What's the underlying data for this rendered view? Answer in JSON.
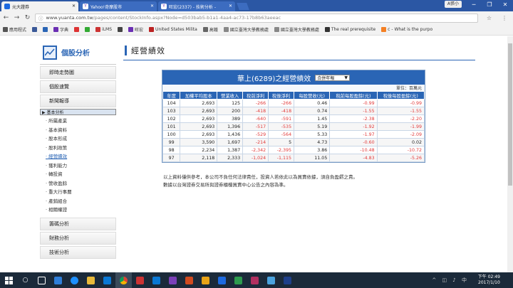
{
  "browser": {
    "tabs": [
      {
        "label": "元大證券",
        "color": "#1d6ae0"
      },
      {
        "label": "Yahoo!奇摩股市",
        "color": "#6b2fb3"
      },
      {
        "label": "旺宏(2337) - 技術分析 -",
        "color": "#6b2fb3"
      }
    ],
    "user_badge": "A張小",
    "url_host": "www.yuanta.com.tw",
    "url_path": "/pages/content/StockInfo.aspx?Node=d503bab5-b1a1-4aa4-ac73-17b8b63aeeac",
    "bookmarks": [
      {
        "label": "應用程式",
        "color": "#555"
      },
      {
        "label": "",
        "color": "#3b5998"
      },
      {
        "label": "",
        "color": "#2a65b5"
      },
      {
        "label": "字典",
        "color": "#6b2fb3"
      },
      {
        "label": "",
        "color": "#d33"
      },
      {
        "label": "",
        "color": "#3a3"
      },
      {
        "label": "iLMS",
        "color": "#c33"
      },
      {
        "label": "",
        "color": "#444"
      },
      {
        "label": "旺宏",
        "color": "#6b2fb3"
      },
      {
        "label": "United States Milita",
        "color": "#b22"
      },
      {
        "label": "高鐵",
        "color": "#666"
      },
      {
        "label": "國立臺灣大學教務處",
        "color": "#888"
      },
      {
        "label": "國立臺灣大學教務處",
        "color": "#888"
      },
      {
        "label": "The real prerequisite",
        "color": "#333"
      },
      {
        "label": "c - What is the purpo",
        "color": "#f48024"
      }
    ]
  },
  "sidebar": {
    "title": "個股分析",
    "top_items": [
      "即時走勢圖",
      "個股速覽",
      "新聞報導"
    ],
    "section": "▶ 基本分析",
    "sub_items": [
      "所屬產業",
      "基本資料",
      "股本形成",
      "股利政策",
      "經營績效",
      "獲利能力",
      "轉投資",
      "營收盈餘",
      "重大行事曆",
      "產銷組合",
      "相關權證"
    ],
    "active_sub": "經營績效",
    "bottom_items": [
      "籌碼分析",
      "財務分析",
      "技術分析"
    ]
  },
  "main": {
    "heading": "經營績效",
    "table_title": "華上(6289)之經營績效",
    "select_value": "合併年報",
    "unit": "單位：百萬元",
    "columns": [
      "年度",
      "加權平均股本",
      "營業收入",
      "稅前淨利",
      "稅後淨利",
      "每股營收(元)",
      "稅前每股盈餘(元)",
      "稅後每股盈餘(元)"
    ],
    "rows": [
      [
        "104",
        "2,693",
        "125",
        "-266",
        "-266",
        "0.46",
        "-0.99",
        "-0.99"
      ],
      [
        "103",
        "2,693",
        "200",
        "-418",
        "-418",
        "0.74",
        "-1.55",
        "-1.55"
      ],
      [
        "102",
        "2,693",
        "389",
        "-640",
        "-591",
        "1.45",
        "-2.38",
        "-2.20"
      ],
      [
        "101",
        "2,693",
        "1,396",
        "-517",
        "-535",
        "5.19",
        "-1.92",
        "-1.99"
      ],
      [
        "100",
        "2,693",
        "1,436",
        "-529",
        "-564",
        "5.33",
        "-1.97",
        "-2.09"
      ],
      [
        "99",
        "3,590",
        "1,697",
        "-214",
        "5",
        "4.73",
        "-0.60",
        "0.02"
      ],
      [
        "98",
        "2,234",
        "1,387",
        "-2,342",
        "-2,395",
        "3.86",
        "-10.48",
        "-10.72"
      ],
      [
        "97",
        "2,118",
        "2,333",
        "-1,024",
        "-1,115",
        "11.05",
        "-4.83",
        "-5.26"
      ]
    ],
    "note_line1": "以上資料僅供參考，本公司不負任何法律責任，投資人若依此以為買賣依據，須自負盈虧之責。",
    "note_line2": "數據以台灣證券交易所與證券櫃檯買賣中心公告之內容為準。"
  },
  "taskbar": {
    "time": "下午 02:49",
    "date": "2017/1/10"
  }
}
